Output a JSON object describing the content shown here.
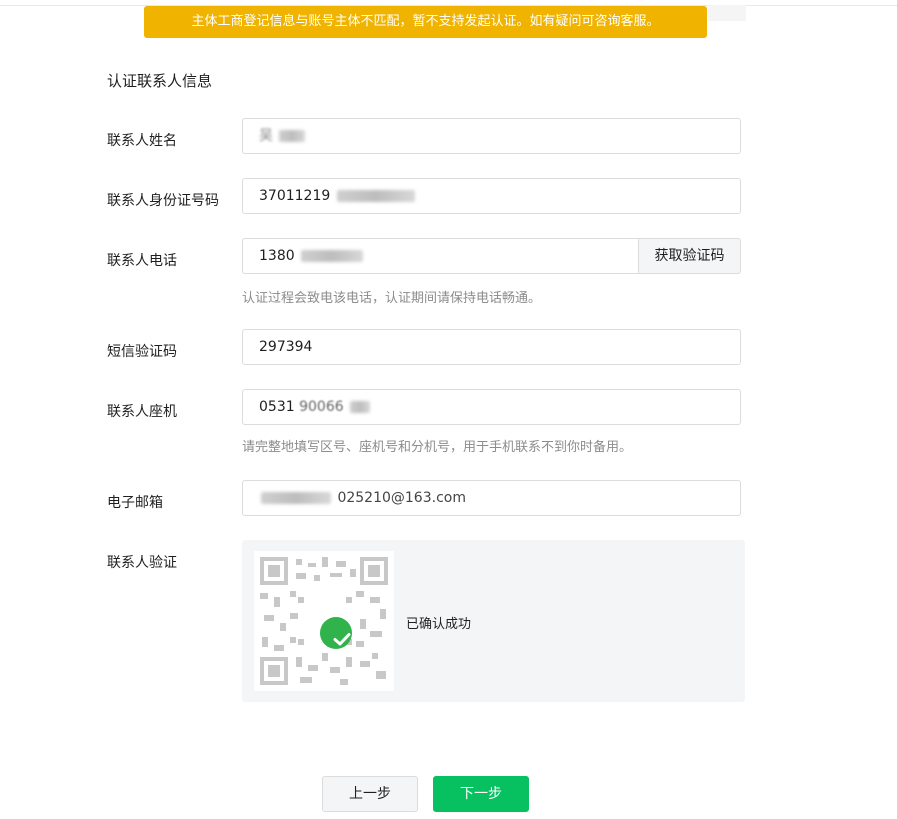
{
  "warning_banner": "主体工商登记信息与账号主体不匹配，暂不支持发起认证。如有疑问可咨询客服。",
  "section_title": "认证联系人信息",
  "fields": {
    "name": {
      "label": "联系人姓名",
      "value": "吴"
    },
    "id_number": {
      "label": "联系人身份证号码",
      "value": "37011219"
    },
    "phone": {
      "label": "联系人电话",
      "value": "1380",
      "get_code": "获取验证码",
      "hint": "认证过程会致电该电话，认证期间请保持电话畅通。"
    },
    "sms_code": {
      "label": "短信验证码",
      "value": "297394"
    },
    "landline": {
      "label": "联系人座机",
      "value_prefix": "0531",
      "value_suffix": "90066",
      "hint": "请完整地填写区号、座机号和分机号，用于手机联系不到你时备用。"
    },
    "email": {
      "label": "电子邮箱",
      "value_suffix": "025210@163.com"
    }
  },
  "contact_verify": {
    "label": "联系人验证",
    "status": "已确认成功"
  },
  "buttons": {
    "prev": "上一步",
    "next": "下一步"
  },
  "colors": {
    "warning": "#f0b400",
    "primary": "#07c160",
    "success": "#2fb34a"
  }
}
